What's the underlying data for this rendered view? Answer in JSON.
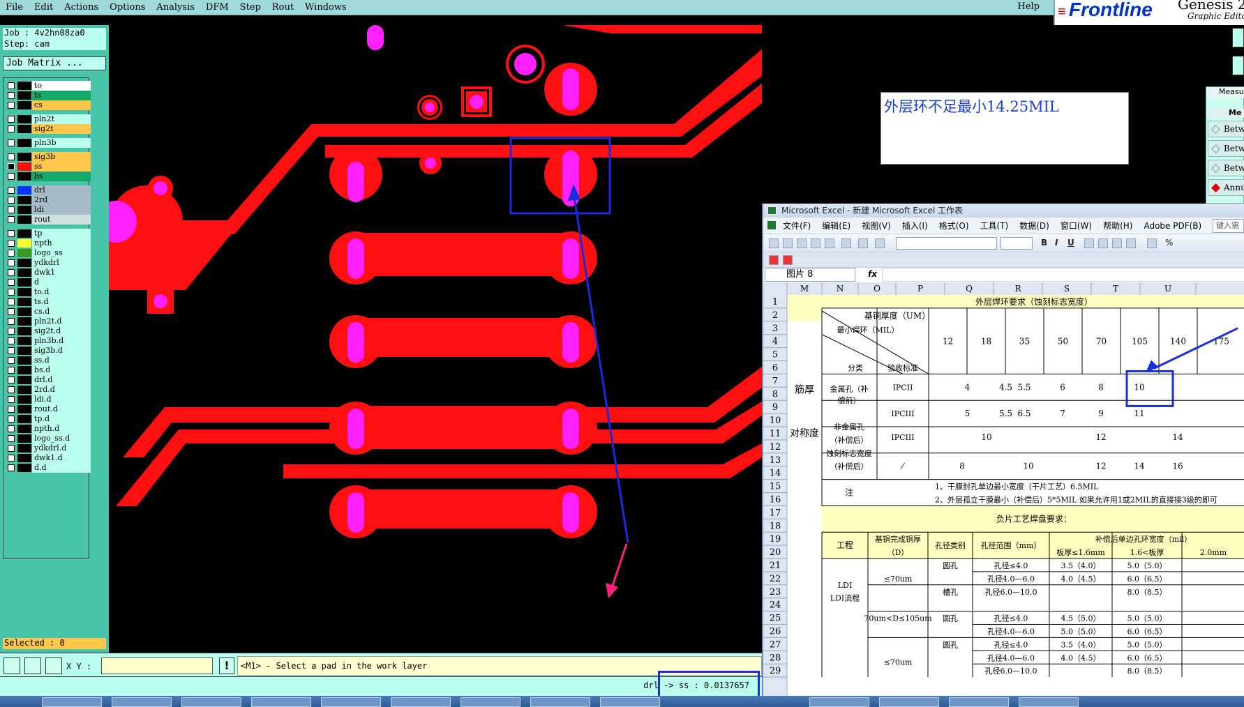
{
  "menu": [
    "File",
    "Edit",
    "Actions",
    "Options",
    "Analysis",
    "DFM",
    "Step",
    "Rout",
    "Windows"
  ],
  "help": "Help",
  "logo": {
    "brand": "Frontline",
    "product": "Genesis 2",
    "subtitle": "Graphic Edito"
  },
  "job": {
    "job_line": "Job : 4v2hn08za0",
    "step_line": "Step: cam",
    "matrix_label": "Job Matrix ..."
  },
  "layers": [
    {
      "name": "to",
      "color": "#ffffff",
      "checked": false
    },
    {
      "name": "ts",
      "color": "#16a86a",
      "checked": false
    },
    {
      "name": "cs",
      "color": "#ffc84a",
      "checked": false
    },
    {
      "name": "pln2t",
      "color": "#bfe",
      "checked": false
    },
    {
      "name": "sig2t",
      "color": "#ffc84a",
      "checked": false
    },
    {
      "name": "pln3b",
      "color": "#bfe",
      "checked": false
    },
    {
      "name": "sig3b",
      "color": "#ffc84a",
      "checked": false
    },
    {
      "name": "ss",
      "color": "#ffc84a",
      "checked": true,
      "swatch": "#ff1010"
    },
    {
      "name": "bs",
      "color": "#16a86a",
      "checked": false
    },
    {
      "name": "drl",
      "color": "#a8bcc8",
      "checked": false,
      "swatch": "#1030ff"
    },
    {
      "name": "2rd",
      "color": "#a8bcc8",
      "checked": false
    },
    {
      "name": "ldi",
      "color": "#a8bcc8",
      "checked": false
    },
    {
      "name": "rout",
      "color": "#cfe0e0",
      "checked": false
    },
    {
      "name": "tp",
      "color": "#bfe",
      "checked": false
    },
    {
      "name": "npth",
      "color": "#bfe",
      "checked": false,
      "swatch": "#ffff30"
    },
    {
      "name": "logo_ss",
      "color": "#bfe",
      "checked": false,
      "swatch": "#3a9a20"
    },
    {
      "name": "ydkdrl",
      "color": "#bfe",
      "checked": false
    },
    {
      "name": "dwk1",
      "color": "#bfe",
      "checked": false
    },
    {
      "name": "d",
      "color": "#bfe",
      "checked": false
    },
    {
      "name": "to.d",
      "color": "#bfe",
      "checked": false
    },
    {
      "name": "ts.d",
      "color": "#bfe",
      "checked": false
    },
    {
      "name": "cs.d",
      "color": "#bfe",
      "checked": false
    },
    {
      "name": "pln2t.d",
      "color": "#bfe",
      "checked": false
    },
    {
      "name": "sig2t.d",
      "color": "#bfe",
      "checked": false
    },
    {
      "name": "pln3b.d",
      "color": "#bfe",
      "checked": false
    },
    {
      "name": "sig3b.d",
      "color": "#bfe",
      "checked": false
    },
    {
      "name": "ss.d",
      "color": "#bfe",
      "checked": false
    },
    {
      "name": "bs.d",
      "color": "#bfe",
      "checked": false
    },
    {
      "name": "drl.d",
      "color": "#bfe",
      "checked": false
    },
    {
      "name": "2rd.d",
      "color": "#bfe",
      "checked": false
    },
    {
      "name": "ldi.d",
      "color": "#bfe",
      "checked": false
    },
    {
      "name": "rout.d",
      "color": "#bfe",
      "checked": false
    },
    {
      "name": "tp.d",
      "color": "#bfe",
      "checked": false
    },
    {
      "name": "npth.d",
      "color": "#bfe",
      "checked": false
    },
    {
      "name": "logo_ss.d",
      "color": "#bfe",
      "checked": false
    },
    {
      "name": "ydkdrl.d",
      "color": "#bfe",
      "checked": false
    },
    {
      "name": "dwk1.d",
      "color": "#bfe",
      "checked": false
    },
    {
      "name": "d.d",
      "color": "#bfe",
      "checked": false
    }
  ],
  "selected": "Selected : 0",
  "note": "外层环不足最小14.25MIL",
  "measure_panel": {
    "title": "Measu",
    "header": "Me",
    "buttons": [
      "Betw",
      "Betw",
      "Betw",
      "Annu"
    ]
  },
  "command": {
    "xy_label": "X Y :",
    "xy_value": "",
    "excl": "!",
    "prompt": "<M1> - Select a pad in the work layer"
  },
  "measurement": "drl -> ss : 0.0137657",
  "excel": {
    "title": "Microsoft Excel - 新建 Microsoft Excel 工作表",
    "menu": [
      "文件(F)",
      "编辑(E)",
      "视图(V)",
      "插入(I)",
      "格式(O)",
      "工具(T)",
      "数据(D)",
      "窗口(W)",
      "帮助(H)",
      "Adobe PDF(B)"
    ],
    "help_box": "键入需",
    "namebox": "图片 8",
    "fx": "fx",
    "columns": [
      "M",
      "N",
      "O",
      "P",
      "Q",
      "R",
      "S",
      "T",
      "U"
    ],
    "rows": [
      "1",
      "2",
      "3",
      "4",
      "5",
      "6",
      "7",
      "8",
      "9",
      "10",
      "11",
      "12",
      "13",
      "14",
      "15",
      "16",
      "17",
      "18",
      "19",
      "20",
      "21",
      "22",
      "23",
      "24",
      "25",
      "26",
      "27",
      "28",
      "29"
    ],
    "table_title": "外层焊环要求（蚀刻标志宽度）",
    "corner": {
      "a": "基铜厚度（UM）",
      "b": "最小焊环（MIL）",
      "c": "分类",
      "d": "验收标准"
    },
    "thickness": [
      "12",
      "18",
      "35",
      "50",
      "70",
      "105",
      "140",
      "175"
    ],
    "side_labels": [
      "筋厚",
      "对称度"
    ],
    "groups": [
      {
        "label": "金属孔（补偿前）",
        "std": "IPCII",
        "values": [
          "4",
          "4.5",
          "5.5",
          "6",
          "8",
          "10"
        ]
      },
      {
        "label": "",
        "std": "IPCIII",
        "values": [
          "5",
          "5.5",
          "6.5",
          "7",
          "9",
          "11"
        ]
      },
      {
        "label": "非金属孔（补偿后）",
        "std": "IPCIII",
        "values": [
          "10",
          "12",
          "14"
        ]
      },
      {
        "label": "蚀刻标志宽度（补偿后）",
        "std": "⁄",
        "values": [
          "8",
          "10",
          "12",
          "14",
          "16"
        ]
      }
    ],
    "notes_label": "注",
    "notes": [
      "1、干膜封孔单边最小宽度（干片工艺）6.5MIL",
      "2、外层孤立干膜最小（补偿后）5*5MIL    如果允许用1或2MIL的直接接3级的即可"
    ],
    "neg_title": "负片工艺焊盘要求：",
    "lower_headers": [
      "工程",
      "基铜完成铜厚（D）",
      "孔径类别",
      "孔径范围（mm）",
      "补偿后单边孔环宽度（mil）"
    ],
    "sub_headers": [
      "板厚≤1.6mm",
      "1.6<板厚",
      "2.0mm"
    ],
    "lower_rows": [
      {
        "flow": "LDI",
        "d": "≤70um",
        "type": "圆孔",
        "range": "孔径≤4.0",
        "v1": "3.5（4.0）",
        "v2": "5.0（5.0）"
      },
      {
        "flow": "LDI流程",
        "d": "",
        "type": "",
        "range": "孔径4.0—6.0",
        "v1": "4.0（4.5）",
        "v2": "6.0（6.5）"
      },
      {
        "flow": "",
        "d": "",
        "type": "槽孔",
        "range": "孔径6.0—10.0",
        "v1": "",
        "v2": "8.0（8.5）"
      },
      {
        "flow": "",
        "d": "70um<D≤105um",
        "type": "圆孔",
        "range": "孔径≤4.0",
        "v1": "4.5（5.0）",
        "v2": "5.0（5.0）"
      },
      {
        "flow": "",
        "d": "",
        "type": "",
        "range": "孔径4.0—6.0",
        "v1": "5.0（5.0）",
        "v2": "6.0（6.5）"
      },
      {
        "flow": "",
        "d": "≤70um",
        "type": "圆孔",
        "range": "孔径≤4.0",
        "v1": "3.5（4.0）",
        "v2": "5.0（5.0）"
      },
      {
        "flow": "",
        "d": "",
        "type": "",
        "range": "孔径4.0—6.0",
        "v1": "4.0（4.5）",
        "v2": "6.0（6.5）"
      },
      {
        "flow": "",
        "d": "",
        "type": "",
        "range": "孔径6.0—10.0",
        "v1": "",
        "v2": "8.0（8.5）"
      }
    ]
  },
  "colors": {
    "copper": "#ff1010",
    "drill": "#ff20ff",
    "annotation": "#1a2be0",
    "pointer": "#ff2080",
    "panel": "#48c4a8"
  }
}
